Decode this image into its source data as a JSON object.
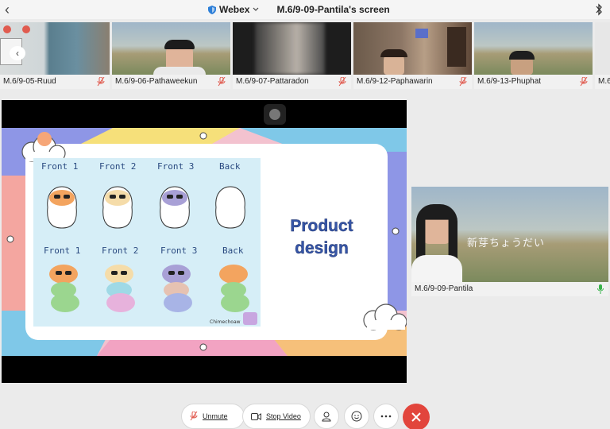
{
  "topbar": {
    "app_name": "Webex",
    "title": "M.6/9-09-Pantila's screen",
    "icons": [
      "back-chevron-icon",
      "shield-icon",
      "chevron-down-icon",
      "bluetooth-icon"
    ]
  },
  "participants": [
    {
      "name": "M.6/9-05-Ruud",
      "muted": true
    },
    {
      "name": "M.6/9-06-Pathaweekun",
      "muted": true
    },
    {
      "name": "M.6/9-07-Pattaradon",
      "muted": true
    },
    {
      "name": "M.6/9-12-Paphawarin",
      "muted": true
    },
    {
      "name": "M.6/9-13-Phuphat",
      "muted": true
    },
    {
      "name": "M.6",
      "muted": false
    }
  ],
  "shared_slide": {
    "title_line1": "Product",
    "title_line2": "design",
    "row1_labels": [
      "Front 1",
      "Front 2",
      "Front 3",
      "Back"
    ],
    "row2_labels": [
      "Front 1",
      "Front 2",
      "Front 3",
      "Back"
    ],
    "signature": "Chimechoaw"
  },
  "self_view": {
    "name": "M.6/9-09-Pantila",
    "background_text": "新芽ちょうだい",
    "mic_active": true
  },
  "controls": {
    "unmute_label": "Unmute",
    "stop_video_label": "Stop Video",
    "icons": [
      "mic-muted-icon",
      "video-camera-icon",
      "participants-icon",
      "reactions-icon",
      "more-icon",
      "end-call-icon"
    ],
    "end_color": "#e2453c"
  }
}
